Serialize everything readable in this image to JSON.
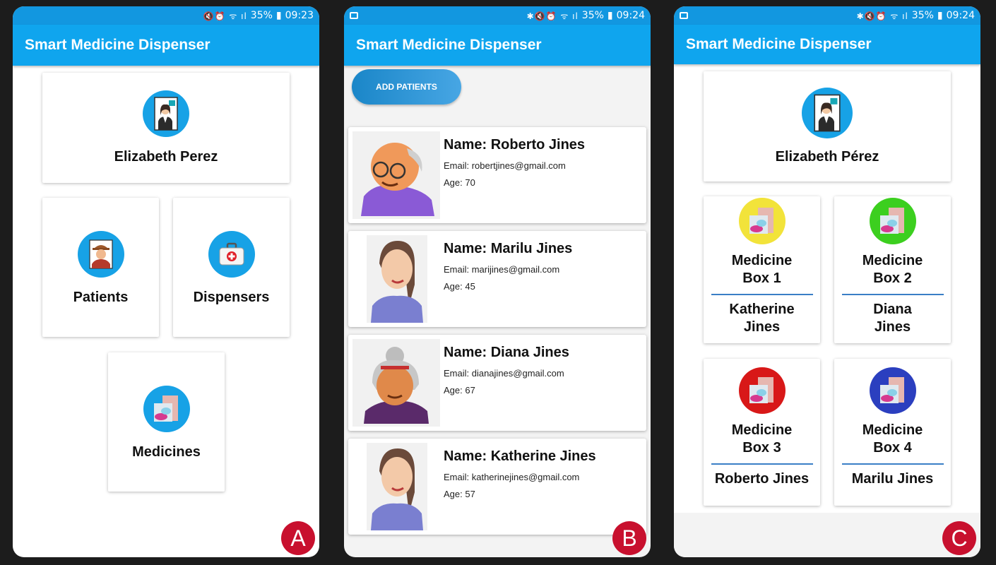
{
  "status": {
    "a": {
      "battery": "35%",
      "time": "09:23"
    },
    "b": {
      "battery": "35%",
      "time": "09:24"
    },
    "c": {
      "battery": "35%",
      "time": "09:24"
    }
  },
  "app_title": "Smart Medicine Dispenser",
  "screen_a": {
    "user_name": "Elizabeth Perez",
    "menu": [
      {
        "label": "Patients"
      },
      {
        "label": "Dispensers"
      },
      {
        "label": "Medicines"
      }
    ],
    "badge": "A"
  },
  "screen_b": {
    "add_button": "ADD PATIENTS",
    "patients": [
      {
        "name": "Name: Roberto Jines",
        "email": "Email: robertjines@gmail.com",
        "age": "Age: 70"
      },
      {
        "name": "Name: Marilu Jines",
        "email": "Email: marijines@gmail.com",
        "age": "Age: 45"
      },
      {
        "name": "Name: Diana Jines",
        "email": "Email: dianajines@gmail.com",
        "age": "Age: 67"
      },
      {
        "name": "Name: Katherine Jines",
        "email": "Email: katherinejines@gmail.com",
        "age": "Age: 57"
      }
    ],
    "badge": "B"
  },
  "screen_c": {
    "user_name": "Elizabeth Pérez",
    "boxes": [
      {
        "line1": "Medicine",
        "line2": "Box 1",
        "patient1": "Katherine",
        "patient2": "Jines",
        "color": "#f2e33a"
      },
      {
        "line1": "Medicine",
        "line2": "Box 2",
        "patient1": "Diana",
        "patient2": "Jines",
        "color": "#3ccf1f"
      },
      {
        "line1": "Medicine",
        "line2": "Box 3",
        "patient1": "Roberto Jines",
        "patient2": "",
        "color": "#d81818"
      },
      {
        "line1": "Medicine",
        "line2": "Box 4",
        "patient1": "Marilu Jines",
        "patient2": "",
        "color": "#2b3fbf"
      }
    ],
    "badge": "C"
  },
  "colors": {
    "accent": "#0fa5ee",
    "status": "#1297e0",
    "badge": "#c8102e"
  }
}
